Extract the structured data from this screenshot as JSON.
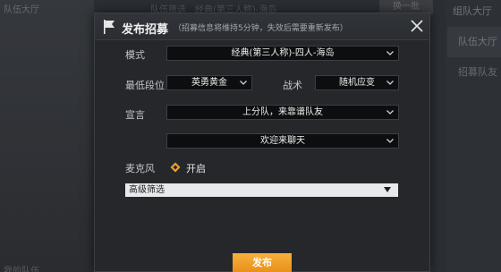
{
  "background": {
    "top_left_title": "队伍大厅",
    "team_filter": "队伍筛选",
    "filter_value": "经典(第三人称)-海岛",
    "one_key_button": "换一批",
    "right_title": "组队大厅",
    "right_tab_team": "队伍大厅",
    "right_tab_recruit": "招募队友",
    "bottom_left_title": "我的队伍"
  },
  "dialog": {
    "title": "发布招募",
    "note": "（招募信息将维持5分钟，失效后需要重新发布）",
    "fields": {
      "mode_label": "模式",
      "mode_value": "经典(第三人称)-四人-海岛",
      "min_rank_label": "最低段位",
      "min_rank_value": "英勇黄金",
      "tactic_label": "战术",
      "tactic_value": "随机应变",
      "slogan_label": "宣言",
      "slogan_value_1": "上分队，来靠谱队友",
      "slogan_value_2": "欢迎来聊天",
      "mic_label": "麦克风",
      "mic_value": "开启"
    },
    "advanced_filter": "高级筛选",
    "publish_button": "发布"
  },
  "colors": {
    "accent_orange": "#f0a030",
    "panel_bg": "#25272b",
    "field_bg": "#0d0e10"
  },
  "icons": {
    "header": "flag-icon",
    "close": "close-icon",
    "dropdown": "chevron-down-icon",
    "mic": "mic-diamond-icon"
  }
}
